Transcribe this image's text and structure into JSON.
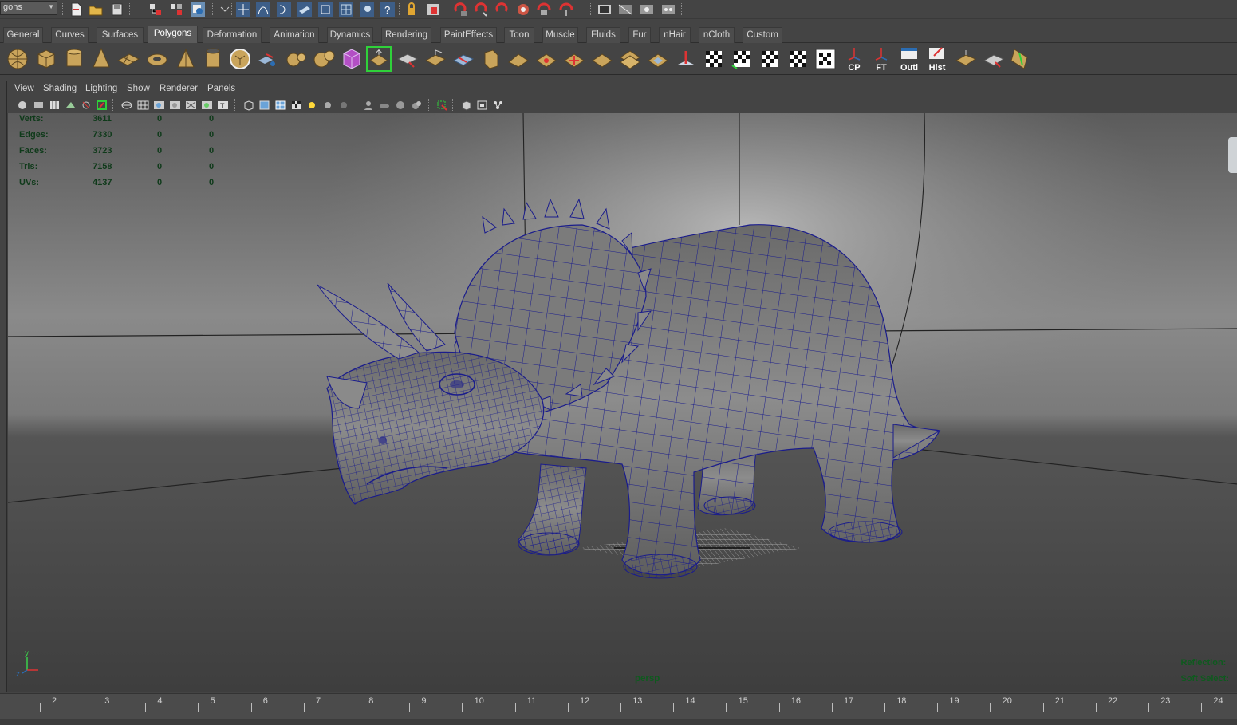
{
  "status_line": {
    "mode_value": "gons",
    "icons": [
      "new-scene-icon",
      "open-scene-icon",
      "save-scene-icon",
      "select-hierarchy-icon",
      "select-object-icon",
      "select-component-icon",
      "snap-grid-icon",
      "snap-curve-icon",
      "snap-point-icon",
      "snap-view-plane-icon",
      "snap-live-icon",
      "render-icon",
      "ipr-render-icon",
      "render-settings-icon",
      "help-icon",
      "lock-icon",
      "construction-history-icon",
      "input-ops-icon",
      "output-ops-icon",
      "magnet-icon",
      "sym-icon",
      "soft-select-icon",
      "render-view-icon",
      "render-current-icon",
      "render-ipr-icon",
      "render-globals-icon"
    ]
  },
  "shelf": {
    "tabs": [
      "General",
      "Curves",
      "Surfaces",
      "Polygons",
      "Deformation",
      "Animation",
      "Dynamics",
      "Rendering",
      "PaintEffects",
      "Toon",
      "Muscle",
      "Fluids",
      "Fur",
      "nHair",
      "nCloth",
      "Custom"
    ],
    "active_tab": "Polygons",
    "text_buttons": {
      "cp": "CP",
      "ft": "FT",
      "outl": "Outl",
      "hist": "Hist"
    }
  },
  "panel": {
    "menus": [
      "View",
      "Shading",
      "Lighting",
      "Show",
      "Renderer",
      "Panels"
    ]
  },
  "hud": {
    "rows": [
      {
        "label": "Verts:",
        "v1": "3611",
        "v2": "0",
        "v3": "0"
      },
      {
        "label": "Edges:",
        "v1": "7330",
        "v2": "0",
        "v3": "0"
      },
      {
        "label": "Faces:",
        "v1": "3723",
        "v2": "0",
        "v3": "0"
      },
      {
        "label": "Tris:",
        "v1": "7158",
        "v2": "0",
        "v3": "0"
      },
      {
        "label": "UVs:",
        "v1": "4137",
        "v2": "0",
        "v3": "0"
      }
    ],
    "camera": "persp",
    "reflection": "Reflection:",
    "soft_select": "Soft Select:",
    "axis_y": "y",
    "axis_z": "z"
  },
  "timeline": {
    "ticks": [
      "2",
      "3",
      "4",
      "5",
      "6",
      "7",
      "8",
      "9",
      "10",
      "11",
      "12",
      "13",
      "14",
      "15",
      "16",
      "17",
      "18",
      "19",
      "20",
      "21",
      "22",
      "23",
      "24"
    ]
  },
  "colors": {
    "wire": "#1a1c8c",
    "hud_text": "#0f3a1a",
    "hud_green": "#0e5a1e",
    "accent_green": "#2fd13a"
  }
}
